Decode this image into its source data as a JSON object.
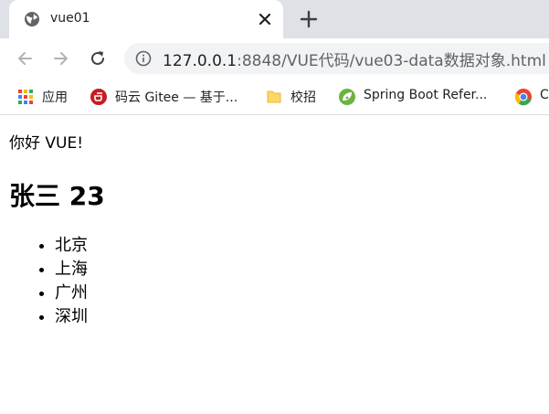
{
  "browser": {
    "tab_title": "vue01",
    "url_host": "127.0.0.1",
    "url_rest": ":8848/VUE代码/vue03-data数据对象.html",
    "bookmarks": [
      {
        "label": "应用",
        "icon": "apps-grid-icon"
      },
      {
        "label": "码云 Gitee — 基于...",
        "icon": "gitee-icon"
      },
      {
        "label": "校招",
        "icon": "folder-icon"
      },
      {
        "label": "Spring Boot Refer...",
        "icon": "spring-icon"
      },
      {
        "label": "C",
        "icon": "chrome-icon"
      }
    ]
  },
  "page": {
    "greeting": "你好 VUE!",
    "person": "张三 23",
    "cities": [
      "北京",
      "上海",
      "广州",
      "深圳"
    ]
  },
  "colors": {
    "tabstrip": "#dee1e6",
    "omnibox": "#f1f3f4",
    "gitee_red": "#c71d23",
    "spring_green": "#6db33f"
  }
}
